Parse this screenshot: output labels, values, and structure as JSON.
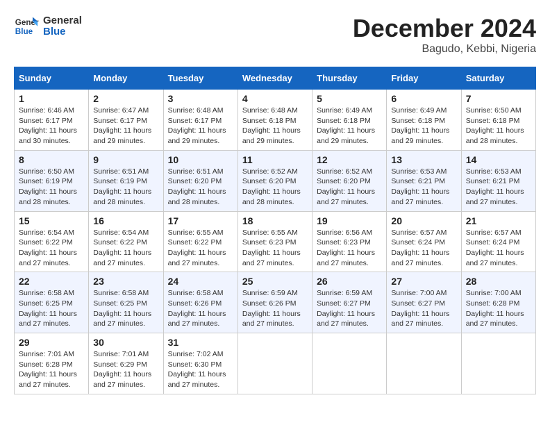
{
  "logo": {
    "text_general": "General",
    "text_blue": "Blue"
  },
  "title": "December 2024",
  "location": "Bagudo, Kebbi, Nigeria",
  "days_of_week": [
    "Sunday",
    "Monday",
    "Tuesday",
    "Wednesday",
    "Thursday",
    "Friday",
    "Saturday"
  ],
  "weeks": [
    [
      {
        "day": "1",
        "sunrise": "6:46 AM",
        "sunset": "6:17 PM",
        "daylight": "11 hours and 30 minutes."
      },
      {
        "day": "2",
        "sunrise": "6:47 AM",
        "sunset": "6:17 PM",
        "daylight": "11 hours and 29 minutes."
      },
      {
        "day": "3",
        "sunrise": "6:48 AM",
        "sunset": "6:17 PM",
        "daylight": "11 hours and 29 minutes."
      },
      {
        "day": "4",
        "sunrise": "6:48 AM",
        "sunset": "6:18 PM",
        "daylight": "11 hours and 29 minutes."
      },
      {
        "day": "5",
        "sunrise": "6:49 AM",
        "sunset": "6:18 PM",
        "daylight": "11 hours and 29 minutes."
      },
      {
        "day": "6",
        "sunrise": "6:49 AM",
        "sunset": "6:18 PM",
        "daylight": "11 hours and 29 minutes."
      },
      {
        "day": "7",
        "sunrise": "6:50 AM",
        "sunset": "6:18 PM",
        "daylight": "11 hours and 28 minutes."
      }
    ],
    [
      {
        "day": "8",
        "sunrise": "6:50 AM",
        "sunset": "6:19 PM",
        "daylight": "11 hours and 28 minutes."
      },
      {
        "day": "9",
        "sunrise": "6:51 AM",
        "sunset": "6:19 PM",
        "daylight": "11 hours and 28 minutes."
      },
      {
        "day": "10",
        "sunrise": "6:51 AM",
        "sunset": "6:20 PM",
        "daylight": "11 hours and 28 minutes."
      },
      {
        "day": "11",
        "sunrise": "6:52 AM",
        "sunset": "6:20 PM",
        "daylight": "11 hours and 28 minutes."
      },
      {
        "day": "12",
        "sunrise": "6:52 AM",
        "sunset": "6:20 PM",
        "daylight": "11 hours and 27 minutes."
      },
      {
        "day": "13",
        "sunrise": "6:53 AM",
        "sunset": "6:21 PM",
        "daylight": "11 hours and 27 minutes."
      },
      {
        "day": "14",
        "sunrise": "6:53 AM",
        "sunset": "6:21 PM",
        "daylight": "11 hours and 27 minutes."
      }
    ],
    [
      {
        "day": "15",
        "sunrise": "6:54 AM",
        "sunset": "6:22 PM",
        "daylight": "11 hours and 27 minutes."
      },
      {
        "day": "16",
        "sunrise": "6:54 AM",
        "sunset": "6:22 PM",
        "daylight": "11 hours and 27 minutes."
      },
      {
        "day": "17",
        "sunrise": "6:55 AM",
        "sunset": "6:22 PM",
        "daylight": "11 hours and 27 minutes."
      },
      {
        "day": "18",
        "sunrise": "6:55 AM",
        "sunset": "6:23 PM",
        "daylight": "11 hours and 27 minutes."
      },
      {
        "day": "19",
        "sunrise": "6:56 AM",
        "sunset": "6:23 PM",
        "daylight": "11 hours and 27 minutes."
      },
      {
        "day": "20",
        "sunrise": "6:57 AM",
        "sunset": "6:24 PM",
        "daylight": "11 hours and 27 minutes."
      },
      {
        "day": "21",
        "sunrise": "6:57 AM",
        "sunset": "6:24 PM",
        "daylight": "11 hours and 27 minutes."
      }
    ],
    [
      {
        "day": "22",
        "sunrise": "6:58 AM",
        "sunset": "6:25 PM",
        "daylight": "11 hours and 27 minutes."
      },
      {
        "day": "23",
        "sunrise": "6:58 AM",
        "sunset": "6:25 PM",
        "daylight": "11 hours and 27 minutes."
      },
      {
        "day": "24",
        "sunrise": "6:58 AM",
        "sunset": "6:26 PM",
        "daylight": "11 hours and 27 minutes."
      },
      {
        "day": "25",
        "sunrise": "6:59 AM",
        "sunset": "6:26 PM",
        "daylight": "11 hours and 27 minutes."
      },
      {
        "day": "26",
        "sunrise": "6:59 AM",
        "sunset": "6:27 PM",
        "daylight": "11 hours and 27 minutes."
      },
      {
        "day": "27",
        "sunrise": "7:00 AM",
        "sunset": "6:27 PM",
        "daylight": "11 hours and 27 minutes."
      },
      {
        "day": "28",
        "sunrise": "7:00 AM",
        "sunset": "6:28 PM",
        "daylight": "11 hours and 27 minutes."
      }
    ],
    [
      {
        "day": "29",
        "sunrise": "7:01 AM",
        "sunset": "6:28 PM",
        "daylight": "11 hours and 27 minutes."
      },
      {
        "day": "30",
        "sunrise": "7:01 AM",
        "sunset": "6:29 PM",
        "daylight": "11 hours and 27 minutes."
      },
      {
        "day": "31",
        "sunrise": "7:02 AM",
        "sunset": "6:30 PM",
        "daylight": "11 hours and 27 minutes."
      },
      null,
      null,
      null,
      null
    ]
  ]
}
